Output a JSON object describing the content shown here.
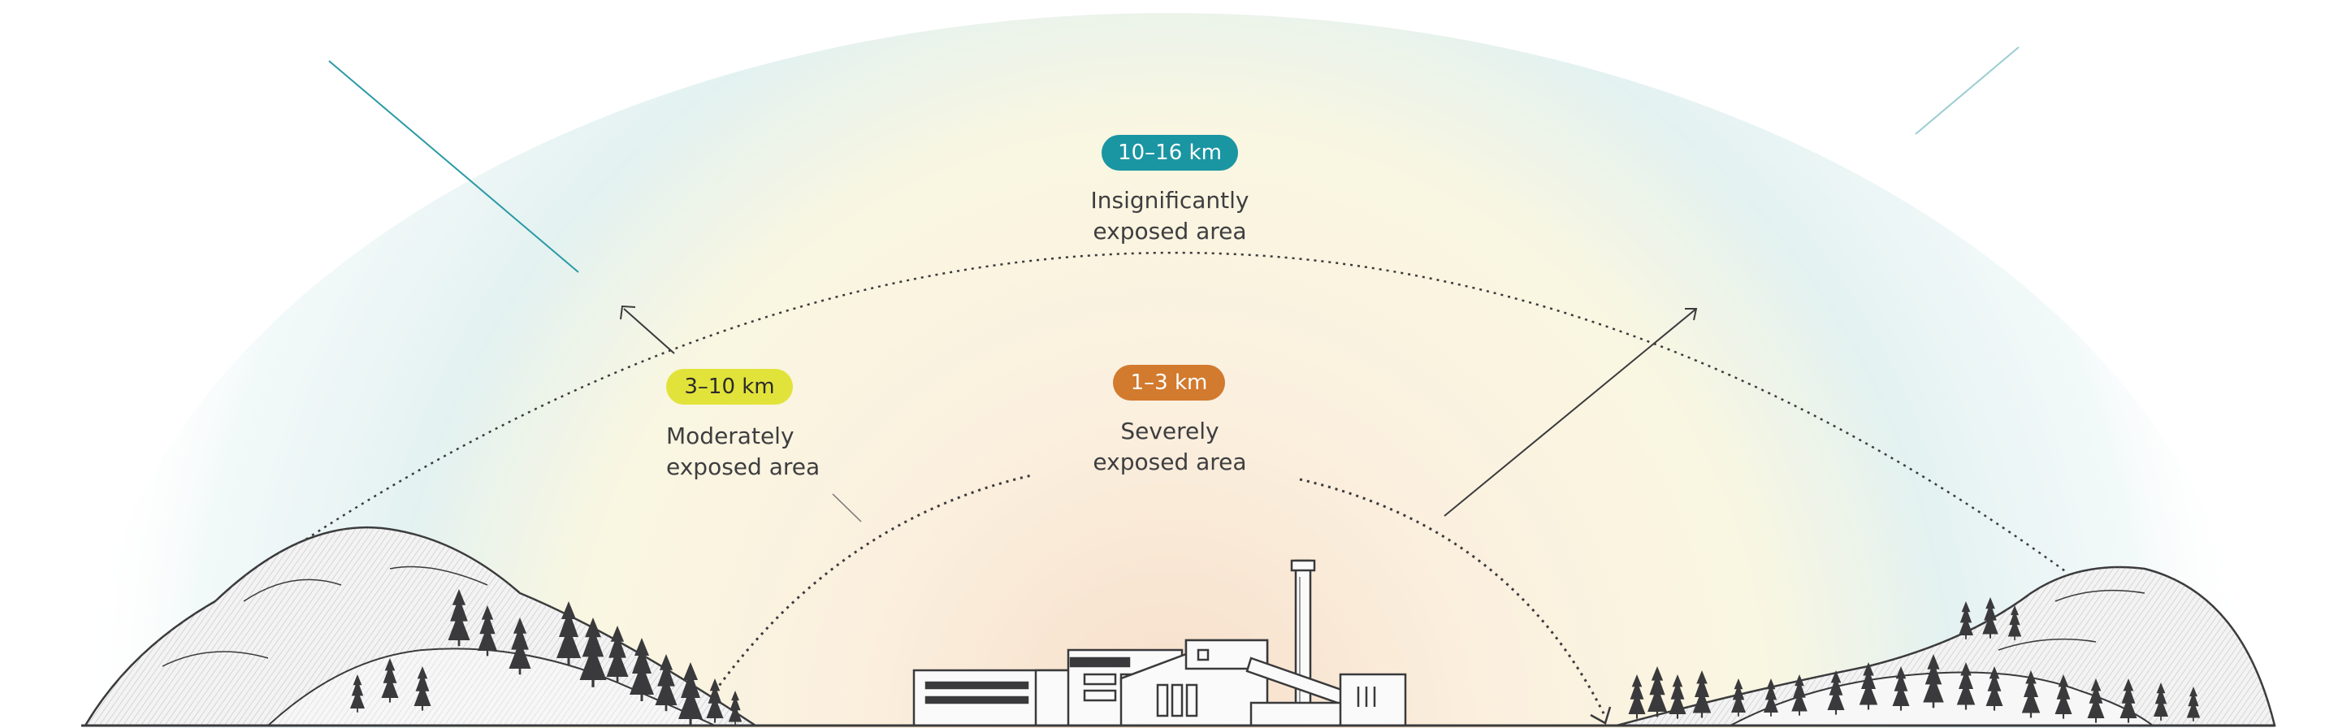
{
  "zones": [
    {
      "id": "severe",
      "range": "1–3 km",
      "label": "Severely\nexposed area",
      "color": "#d27a2e",
      "text_color": "#ffffff"
    },
    {
      "id": "moderate",
      "range": "3–10 km",
      "label": "Moderately\nexposed area",
      "color": "#e2e33a",
      "text_color": "#2b2b2b"
    },
    {
      "id": "insignificant",
      "range": "10–16 km",
      "label": "Insignificantly\nexposed area",
      "color": "#1a95a2",
      "text_color": "#ffffff"
    }
  ],
  "palette": {
    "glow_inner": "#f6dfc8",
    "glow_mid": "#fbf1d6",
    "glow_outer": "#dcefef",
    "ink": "#3a3a3c",
    "hill_fill": "#f2f2f2"
  }
}
